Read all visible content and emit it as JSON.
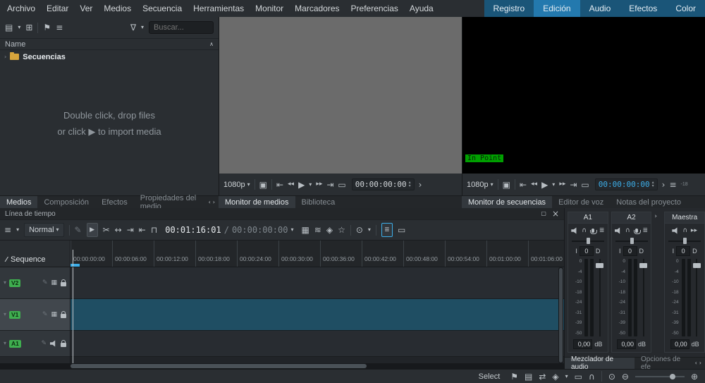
{
  "glyphs": {
    "hamburger": "≡",
    "chevron_down": "▾",
    "chevron_up": "∧",
    "chevron_right": "›",
    "chevron_left": "‹",
    "funnel": "∇",
    "add_clip": "▤",
    "create_folder": "⊞",
    "tag": "⚑",
    "rewind": "◂◂",
    "play": "▶",
    "forward": "▸▸",
    "zone_start": "⇤",
    "zone_end": "⇥",
    "grab_frame": "▣",
    "loop_zone": "▭",
    "select_tool": "▶",
    "scissors": "✂",
    "spacer_tool": "↔",
    "mix": "⊓",
    "grid": "▦",
    "waveform": "≋",
    "marker": "◈",
    "star": "☆",
    "target": "⊙",
    "sliders": "≣",
    "keyboard": "▭",
    "pencil": "✎",
    "float": "▢",
    "close": "×",
    "swap": "⇄",
    "magnet": "∩",
    "zoom_in": "⊕",
    "zoom_out": "⊖",
    "zoom_fit": "⊙",
    "headphones": "∩",
    "spin_up": "▴",
    "spin_down": "▾",
    "sequence": "∕∕"
  },
  "menubar": {
    "items": [
      "Archivo",
      "Editar",
      "Ver",
      "Medios",
      "Secuencia",
      "Herramientas",
      "Monitor",
      "Marcadores",
      "Preferencias",
      "Ayuda"
    ],
    "workspaces": [
      "Registro",
      "Edición",
      "Audio",
      "Efectos",
      "Color"
    ],
    "active_workspace": "Edición"
  },
  "bin": {
    "search_placeholder": "Buscar...",
    "name_header": "Name",
    "folder_label": "Secuencias",
    "empty_line1": "Double click, drop files",
    "empty_line2": "or click ▶ to import media",
    "tabs": [
      "Medios",
      "Composición",
      "Efectos",
      "Propiedades del medio"
    ],
    "active_tab": "Medios"
  },
  "clip_monitor": {
    "resolution": "1080p",
    "timecode": "00:00:00:00",
    "tabs": [
      "Monitor de medios",
      "Biblioteca"
    ],
    "active_tab": "Monitor de medios"
  },
  "project_monitor": {
    "resolution": "1080p",
    "timecode": "00:00:00:00",
    "in_point_label": "In Point",
    "meter_label": "-18",
    "tabs": [
      "Monitor de secuencias",
      "Editor de voz",
      "Notas del proyecto"
    ],
    "active_tab": "Monitor de secuencias"
  },
  "timeline": {
    "title": "Línea de tiempo",
    "mode": "Normal",
    "tc_current": "00:01:16:01",
    "tc_separator": "/",
    "tc_total": "00:00:00:00",
    "sequence_label": "Sequence",
    "ruler": [
      "00:00:00:00",
      "00:00:06:00",
      "00:00:12:00",
      "00:00:18:00",
      "00:00:24:00",
      "00:00:30:00",
      "00:00:36:00",
      "00:00:42:00",
      "00:00:48:00",
      "00:00:54:00",
      "00:01:00:00",
      "00:01:06:00"
    ],
    "tracks": [
      {
        "label": "V2",
        "type": "video",
        "selected": false
      },
      {
        "label": "V1",
        "type": "video",
        "selected": true
      },
      {
        "label": "A1",
        "type": "audio",
        "selected": false
      }
    ]
  },
  "mixer": {
    "channels": [
      {
        "name": "A1",
        "balance": "0",
        "db": "0,00"
      },
      {
        "name": "A2",
        "balance": "0",
        "db": "0,00"
      },
      {
        "name": "Maestra",
        "balance": "0",
        "db": "0,00"
      }
    ],
    "balance_left": "I",
    "balance_right": "D",
    "db_unit": "dB",
    "scale": [
      "0",
      "-4",
      "-10",
      "-18",
      "-24",
      "-31",
      "-39",
      "-50"
    ],
    "tabs": [
      "Mezclador de audio",
      "Opciones de efe"
    ],
    "active_tab": "Mezclador de audio"
  },
  "statusbar": {
    "tool": "Select"
  },
  "colors": {
    "accent": "#3daee9",
    "workspace_active": "#2379ae",
    "in_point_green": "#00a000",
    "track_badge_green": "#3fae4f",
    "selected_lane": "#1f4e63"
  }
}
